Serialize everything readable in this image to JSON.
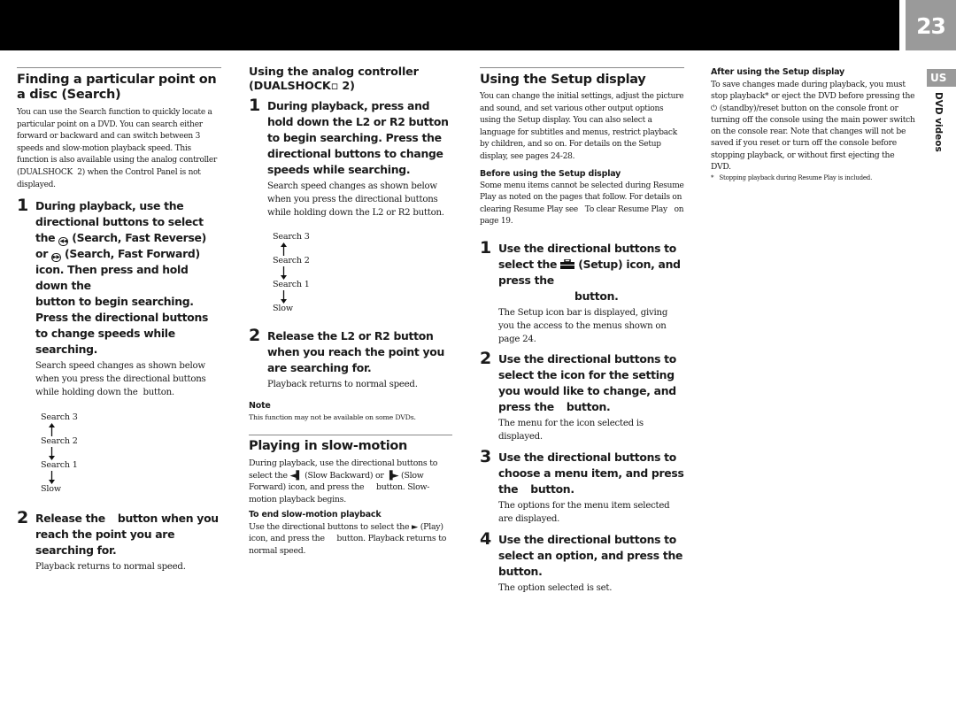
{
  "header": {
    "page_number": "23",
    "region_tab": "US",
    "section_tab": "DVD videos"
  },
  "col1": {
    "heading": "Finding a particular point on a disc (Search)",
    "intro": "You can use the Search function to quickly locate a particular point on a DVD. You can search either forward or backward and can switch between 3 speeds and slow-motion playback speed. This function is also available using the analog controller (DUALSHOCK  2) when the Control Panel is not displayed.",
    "steps": [
      {
        "num": "1",
        "title_a": "During playback, use the directional buttons to select the ",
        "icon_a": "search-fast-reverse",
        "title_b": " (Search, Fast Reverse) or ",
        "icon_b": "search-fast-forward",
        "title_c": " (Search, Fast Forward) icon. Then press and hold down the",
        "title_d": "button to begin searching. Press the directional buttons to change speeds while searching.",
        "desc": "Search speed changes as shown below when you press the directional buttons while holding down the  button."
      },
      {
        "num": "2",
        "title_a": "Release the",
        "title_b": "button when you reach the point you are searching for.",
        "desc": "Playback returns to normal speed."
      }
    ],
    "diagram": [
      "Search 3",
      "Search 2",
      "Search 1",
      "Slow"
    ]
  },
  "col2": {
    "heading": "Using the analog controller (DUALSHOCK▫ 2)",
    "steps": [
      {
        "num": "1",
        "title": "During playback, press and hold down the L2 or R2 button to begin searching. Press the directional buttons to change speeds while searching.",
        "desc": "Search speed changes as shown below when you press the directional buttons while holding down the L2 or R2 button."
      },
      {
        "num": "2",
        "title": "Release the L2 or R2 button when you reach the point you are searching for.",
        "desc": "Playback returns to normal speed."
      }
    ],
    "diagram": [
      "Search 3",
      "Search 2",
      "Search 1",
      "Slow"
    ],
    "note_label": "Note",
    "note_text": "This function may not be available on some DVDs.",
    "slow_heading": "Playing in slow-motion",
    "slow_a": "During playback, use the directional buttons to select the ",
    "slow_icon_a": "◄▌",
    "slow_b": " (Slow Backward) or ",
    "slow_icon_b": "▐►",
    "slow_c": " (Slow Forward) icon, and press the     button. Slow-motion playback begins.",
    "end_heading": "To end slow-motion playback",
    "end_a": "Use the directional buttons to select the ",
    "end_icon": "►",
    "end_b": " (Play) icon, and press the     button. Playback returns to normal speed."
  },
  "col3": {
    "heading": "Using the Setup display",
    "intro": "You can change the initial settings, adjust the picture and sound, and set various other output options using the Setup display. You can also select a language for subtitles and menus, restrict playback by children, and so on. For details on the Setup display, see pages 24-28.",
    "before_heading": "Before using the Setup display",
    "before_text": "Some menu items cannot be selected during Resume Play as noted on the pages that follow. For details on clearing Resume Play see   To clear Resume Play   on page 19.",
    "steps": [
      {
        "num": "1",
        "title_a": "Use the directional buttons to select the ",
        "title_b": " (Setup) icon, and press the",
        "title_c": "button.",
        "desc": "The Setup icon bar is displayed, giving you the access to the menus shown on page 24."
      },
      {
        "num": "2",
        "title_a": "Use the directional buttons to select the icon for the setting you would like to change, and press the",
        "title_b": "button.",
        "desc": "The menu for the icon selected is displayed."
      },
      {
        "num": "3",
        "title_a": "Use the directional buttons to choose a menu item, and press the",
        "title_b": "button.",
        "desc": "The options for the menu item selected are displayed."
      },
      {
        "num": "4",
        "title_a": "Use the directional buttons to select an option, and press the",
        "title_b": "button.",
        "desc": "The option selected is set."
      }
    ]
  },
  "col4": {
    "after_heading": "After using the Setup display",
    "after_a": "To save changes made during playback, you must stop playback* or eject the DVD before pressing the ",
    "standby_icon": "⏻",
    "after_b": " (standby)/reset button on the console front or turning off the console using the main power switch on the console rear. Note that changes will not be saved if you reset or turn off the console before stopping playback, or without first ejecting the DVD.",
    "footnote": "*   Stopping playback during Resume Play is included."
  }
}
